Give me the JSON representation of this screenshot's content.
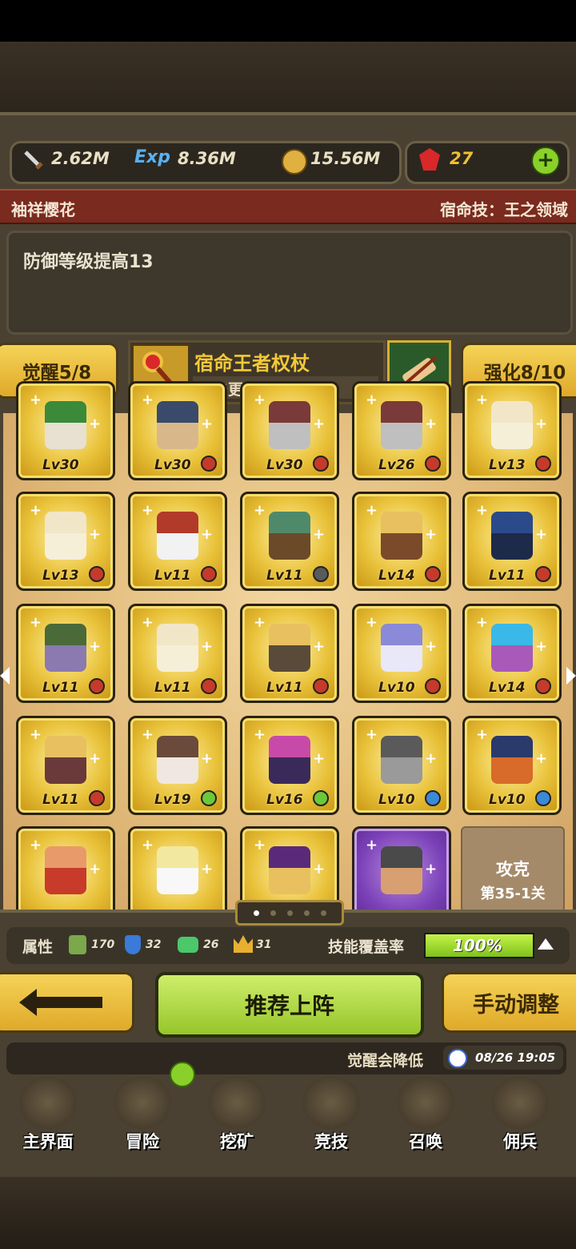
{
  "resources": {
    "attack": "2.62M",
    "exp_label": "Exp",
    "exp": "8.36M",
    "gold": "15.56M",
    "gems": "27"
  },
  "hero": {
    "name": "袖祥樱花",
    "fate_skill": "宿命技：王之领域",
    "description": "防御等级提高13"
  },
  "buttons": {
    "awaken": "觉醒5/8",
    "enhance": "强化8/10",
    "weapon_name": "宿命王者权杖",
    "weapon_hint": "点击更换武器",
    "recommend": "推荐上阵",
    "manual": "手动调整"
  },
  "grid": {
    "rows": [
      [
        {
          "lv": "Lv30",
          "badge": "",
          "c1": "#3a8a3a",
          "c2": "#e8e0d0"
        },
        {
          "lv": "Lv30",
          "badge": "red",
          "c1": "#3a4a6a",
          "c2": "#d8b88a"
        },
        {
          "lv": "Lv30",
          "badge": "red",
          "c1": "#7a3a3a",
          "c2": "#bfbfbf"
        },
        {
          "lv": "Lv26",
          "badge": "red",
          "c1": "#7a3a3a",
          "c2": "#bfbfbf"
        },
        {
          "lv": "Lv13",
          "badge": "red",
          "c1": "#f1e6c8",
          "c2": "#f6efd8"
        }
      ],
      [
        {
          "lv": "Lv13",
          "badge": "red",
          "c1": "#f1e6c8",
          "c2": "#f6efd8"
        },
        {
          "lv": "Lv11",
          "badge": "red",
          "c1": "#b23a2a",
          "c2": "#f2f2f2"
        },
        {
          "lv": "Lv11",
          "badge": "gray",
          "c1": "#4e8a6a",
          "c2": "#6b4a2a"
        },
        {
          "lv": "Lv14",
          "badge": "red",
          "c1": "#e8c060",
          "c2": "#7a4a2a"
        },
        {
          "lv": "Lv11",
          "badge": "red",
          "c1": "#2a4a8a",
          "c2": "#1e2a4a"
        }
      ],
      [
        {
          "lv": "Lv11",
          "badge": "red",
          "c1": "#4a6a3a",
          "c2": "#8a7ab0"
        },
        {
          "lv": "Lv11",
          "badge": "red",
          "c1": "#f1e6c8",
          "c2": "#f6efd8"
        },
        {
          "lv": "Lv11",
          "badge": "red",
          "c1": "#e8c060",
          "c2": "#5a4a3a"
        },
        {
          "lv": "Lv10",
          "badge": "red",
          "c1": "#8a8ad8",
          "c2": "#e8e8f8"
        },
        {
          "lv": "Lv14",
          "badge": "red",
          "c1": "#3ab8e8",
          "c2": "#a85ab8"
        }
      ],
      [
        {
          "lv": "Lv11",
          "badge": "red",
          "c1": "#e8c060",
          "c2": "#6a3a3a"
        },
        {
          "lv": "Lv19",
          "badge": "green",
          "c1": "#6a4a3a",
          "c2": "#f0e8e0"
        },
        {
          "lv": "Lv16",
          "badge": "green",
          "c1": "#c84aa8",
          "c2": "#3a2a5a"
        },
        {
          "lv": "Lv10",
          "badge": "blue",
          "c1": "#5a5a5a",
          "c2": "#9a9a9a"
        },
        {
          "lv": "Lv10",
          "badge": "blue",
          "c1": "#2a3a6a",
          "c2": "#d86a2a"
        }
      ],
      [
        {
          "lv": "",
          "badge": "",
          "c1": "#e89a6a",
          "c2": "#c83a2a"
        },
        {
          "lv": "",
          "badge": "",
          "c1": "#f2e8a0",
          "c2": "#f8f8f8"
        },
        {
          "lv": "",
          "badge": "",
          "c1": "#5a2a7a",
          "c2": "#e8c060"
        },
        {
          "lv": "",
          "badge": "",
          "c1": "#4a4a4a",
          "c2": "#d8a070"
        }
      ]
    ],
    "locked_title": "攻克",
    "locked_stage": "第35-1关"
  },
  "attributes": {
    "label": "属性",
    "v1": "170",
    "v2": "32",
    "v3": "26",
    "v4": "31",
    "skill_label": "技能覆盖率",
    "skill_value": "100%",
    "skill_fill": 1.0
  },
  "ticker": {
    "text": "觉醒会降低",
    "time": "08/26 19:05"
  },
  "nav": [
    {
      "label": "主界面",
      "icon": "map-scroll-icon"
    },
    {
      "label": "冒险",
      "icon": "island-icon"
    },
    {
      "label": "挖矿",
      "icon": "pickaxe-icon"
    },
    {
      "label": "竞技",
      "icon": "crossed-swords-icon"
    },
    {
      "label": "召唤",
      "icon": "summon-scroll-icon"
    },
    {
      "label": "佣兵",
      "icon": "tent-icon"
    }
  ],
  "colors": {
    "panel": "#4a4132",
    "title_bar": "#7a2a1e",
    "accent_yellow": "#e0a92a",
    "accent_green": "#97c52a"
  }
}
